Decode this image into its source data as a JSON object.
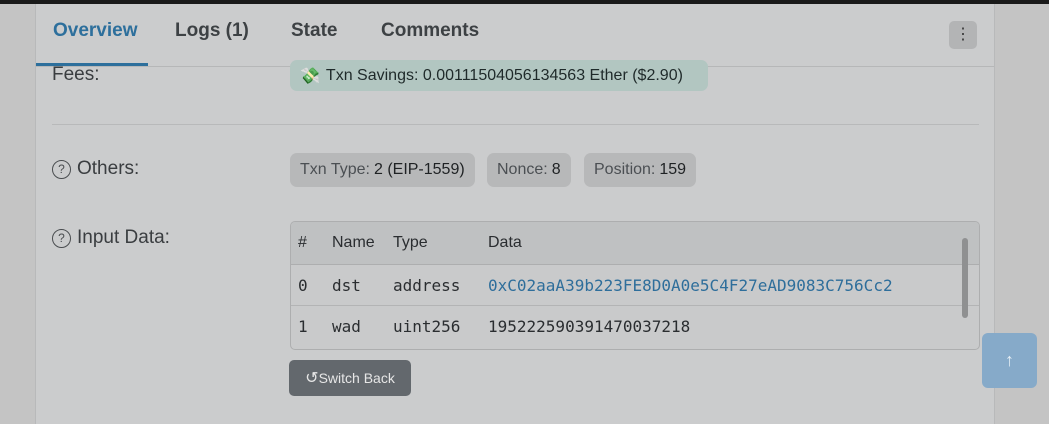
{
  "tabs": [
    {
      "label": "Overview"
    },
    {
      "label": "Logs (1)"
    },
    {
      "label": "State"
    },
    {
      "label": "Comments"
    }
  ],
  "more_icon": "⋮",
  "fees": {
    "label": "Fees:",
    "savings_icon": "💸",
    "savings_text": "Txn Savings: 0.00111504056134563 Ether ($2.90)"
  },
  "others": {
    "help_icon": "?",
    "label": "Others:",
    "txn_type": {
      "key": "Txn Type:",
      "value": "2 (EIP-1559)"
    },
    "nonce": {
      "key": "Nonce:",
      "value": "8"
    },
    "position": {
      "key": "Position:",
      "value": "159"
    }
  },
  "input_data": {
    "help_icon": "?",
    "label": "Input Data:",
    "columns": [
      "#",
      "Name",
      "Type",
      "Data"
    ],
    "rows": [
      {
        "index": "0",
        "name": "dst",
        "type": "address",
        "data": "0xC02aaA39b223FE8D0A0e5C4F27eAD9083C756Cc2"
      },
      {
        "index": "1",
        "name": "wad",
        "type": "uint256",
        "data": "195222590391470037218"
      }
    ],
    "switch_icon": "↺",
    "switch_label": "Switch Back"
  },
  "scroll_top_icon": "↑",
  "colors": {
    "accent": "#2d6f9c",
    "link": "#2e6e9b",
    "button_dark": "#63686d",
    "scroll_top": "#86aac9"
  }
}
